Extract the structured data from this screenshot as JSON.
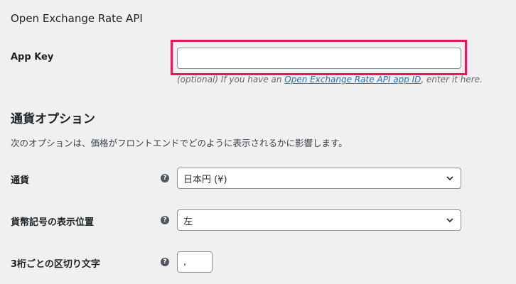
{
  "oer": {
    "title": "Open Exchange Rate API",
    "app_key_label": "App Key",
    "app_key_value": "",
    "hint_prefix": "(optional) If you have an ",
    "hint_link": "Open Exchange Rate API app ID",
    "hint_suffix": ", enter it here."
  },
  "currency_options": {
    "title": "通貨オプション",
    "description": "次のオプションは、価格がフロントエンドでどのように表示されるかに影響します。",
    "fields": {
      "currency": {
        "label": "通貨",
        "selected": "日本円 (¥)"
      },
      "position": {
        "label": "貨幣記号の表示位置",
        "selected": "左"
      },
      "thousand_sep": {
        "label": "3桁ごとの区切り文字",
        "value": ","
      }
    },
    "help_glyph": "?"
  },
  "colors": {
    "highlight": "#e8175d",
    "link": "#2271b1",
    "background": "#f0f0f1"
  },
  "icons": {
    "help": "question-circle-icon",
    "dropdown": "chevron-down-icon"
  }
}
